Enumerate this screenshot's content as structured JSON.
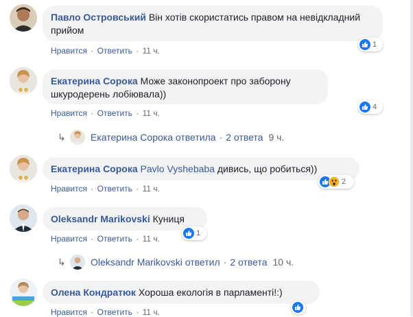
{
  "colors": {
    "link": "#385898",
    "bubble": "#f2f3f5",
    "muted": "#606770",
    "like_blue": "#1877f2",
    "wow_yellow": "#f7b125"
  },
  "actions": {
    "like": "Нравится",
    "reply": "Ответить",
    "sep": "·"
  },
  "comments": [
    {
      "author": "Павло Островський",
      "text": "Він хотів скористатись правом на невідкладний прийом",
      "time": "11 ч.",
      "reactions": [
        "like-icon"
      ],
      "reaction_count": "1"
    },
    {
      "author": "Екатерина Сорока",
      "text": "Може законопроект про заборону шкуродерень лобіювала))",
      "time": "11 ч.",
      "reactions": [
        "like-icon"
      ],
      "reaction_count": "4",
      "replies": {
        "name": "Екатерина Сорока",
        "verb": "ответила",
        "count": "2 ответа",
        "time": "9 ч."
      }
    },
    {
      "author": "Екатерина Сорока",
      "mention": "Pavlo Vyshebaba",
      "text": "дивись, що робиться))",
      "time": "11 ч.",
      "reactions": [
        "like-icon",
        "wow-icon"
      ],
      "reaction_count": "2"
    },
    {
      "author": "Oleksandr Marikovski",
      "text": "Куниця",
      "time": "11 ч.",
      "reactions": [
        "like-icon"
      ],
      "reaction_count": "1",
      "replies": {
        "name": "Oleksandr Marikovski",
        "verb": "ответил",
        "count": "2 ответа",
        "time": "10 ч."
      }
    },
    {
      "author": "Олена Кондратюк",
      "text": "Хороша екологія в парламенті!:)",
      "time": "11 ч.",
      "reactions": [
        "like-icon"
      ],
      "reaction_count": ""
    }
  ]
}
